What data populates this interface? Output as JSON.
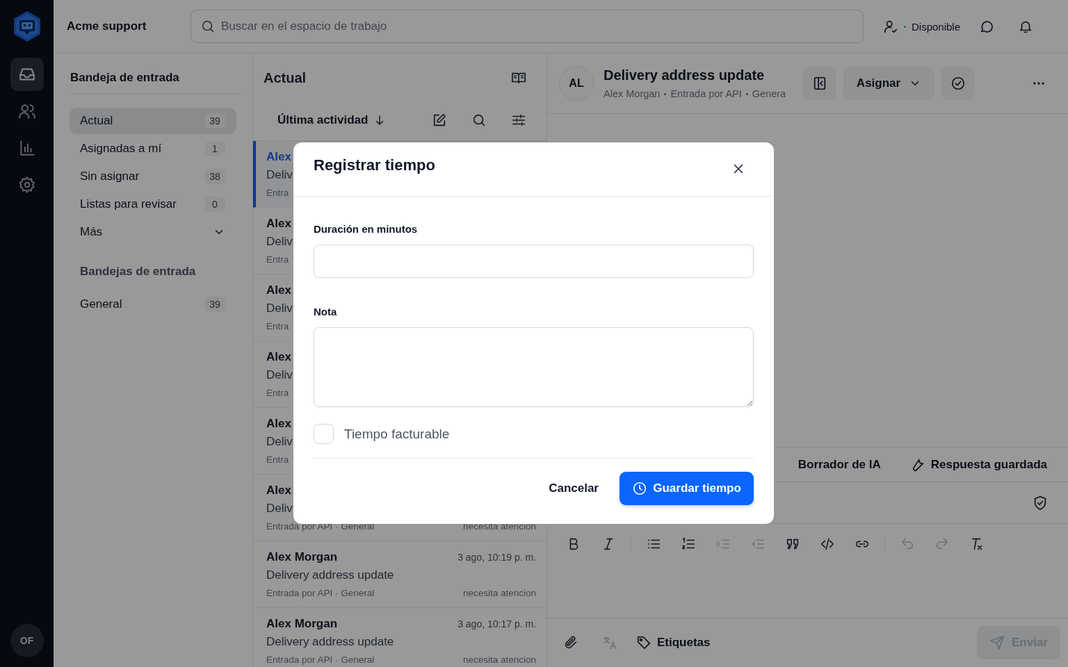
{
  "app": {
    "workspace": "Acme support",
    "search_placeholder": "Buscar en el espacio de trabajo",
    "status": "Disponible",
    "user_initials": "OF"
  },
  "nav": [
    {
      "selected": true
    },
    {
      "selected": false
    },
    {
      "selected": false
    },
    {
      "selected": false
    }
  ],
  "folders": {
    "title": "Bandeja de entrada",
    "items": [
      {
        "label": "Actual",
        "count": "39",
        "selected": true
      },
      {
        "label": "Asignadas a mí",
        "count": "1",
        "selected": false
      },
      {
        "label": "Sin asignar",
        "count": "38",
        "selected": false
      },
      {
        "label": "Listas para revisar",
        "count": "0",
        "selected": false
      }
    ],
    "more": "Más",
    "section": "Bandejas de entrada",
    "inboxes": [
      {
        "label": "General",
        "count": "39",
        "selected": false
      }
    ]
  },
  "list": {
    "title": "Actual",
    "sort": "Última actividad",
    "rows": [
      {
        "name": "Alex",
        "subject": "Deliv",
        "meta": "Entra",
        "selected": true
      },
      {
        "name": "Alex",
        "subject": "Deliv",
        "meta": "Entra",
        "selected": false
      },
      {
        "name": "Alex",
        "subject": "Deliv",
        "meta": "Entra",
        "selected": false
      },
      {
        "name": "Alex",
        "subject": "Deliv",
        "meta": "Entra",
        "selected": false
      },
      {
        "name": "Alex",
        "subject": "Deliv",
        "meta": "Entra",
        "selected": false
      },
      {
        "name": "Alex",
        "subject": "Deliv",
        "meta": "Entrada por API · General",
        "status": "necesita atencion",
        "selected": false
      },
      {
        "name": "Alex Morgan",
        "time": "3 ago, 10:19 p. m.",
        "subject": "Delivery address update",
        "meta": "Entrada por API · General",
        "status": "necesita atencion",
        "selected": false
      },
      {
        "name": "Alex Morgan",
        "time": "3 ago, 10:17 p. m.",
        "subject": "Delivery address update",
        "meta": "Entrada por API · General",
        "status": "necesita atencion",
        "selected": false
      }
    ]
  },
  "conversation": {
    "initials": "AL",
    "title": "Delivery address update",
    "meta": [
      "Alex Morgan",
      "Entrada por API",
      "Genera"
    ],
    "assign": "Asignar",
    "tabs": [
      "Borrador de IA",
      "Respuesta guardada"
    ],
    "toolbar": [
      {
        "disabled": false
      },
      {
        "disabled": false
      },
      {
        "disabled": false
      },
      {
        "disabled": false
      },
      {
        "disabled": true
      },
      {
        "disabled": true
      },
      {
        "disabled": false
      },
      {
        "disabled": false
      },
      {
        "disabled": false
      },
      {
        "disabled": true
      },
      {
        "disabled": true
      },
      {
        "disabled": false
      }
    ],
    "translate": {
      "disabled": true
    },
    "tags": "Etiquetas",
    "send": {
      "label": "Enviar",
      "disabled": true
    }
  },
  "modal": {
    "title": "Registrar tiempo",
    "fields": [
      {
        "label": "Duración en minutos",
        "kind": "input"
      },
      {
        "label": "Nota",
        "kind": "textarea"
      }
    ],
    "checkbox": {
      "label": "Tiempo facturable",
      "checked": false
    },
    "cancel": "Cancelar",
    "save": "Guardar tiempo"
  }
}
